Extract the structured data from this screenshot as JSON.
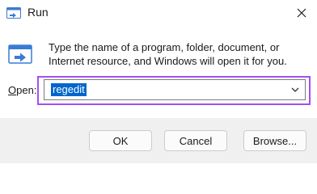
{
  "window": {
    "title": "Run",
    "title_icon": "run-icon",
    "close_icon": "close-icon"
  },
  "dialog": {
    "description": "Type the name of a program, folder, document, or Internet resource, and Windows will open it for you.",
    "open_label": "Open:",
    "open_label_access_key": "O",
    "input_value": "regedit",
    "dropdown_icon": "chevron-down-icon",
    "highlight_color": "#a44ff0",
    "selection_color": "#0066cc"
  },
  "buttons": {
    "ok": "OK",
    "cancel": "Cancel",
    "browse": "Browse..."
  }
}
